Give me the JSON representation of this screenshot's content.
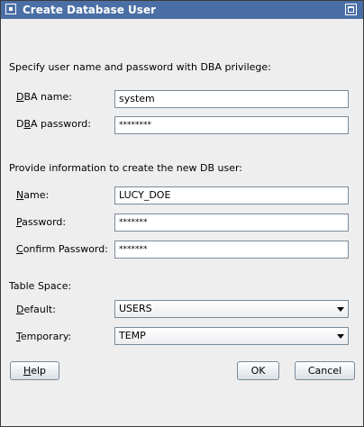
{
  "window": {
    "title": "Create Database User"
  },
  "dba_section": {
    "heading": "Specify user name and password with DBA privilege:",
    "name_label_mnemonic": "D",
    "name_label_rest": "BA name:",
    "name_value": "system",
    "password_label_pre": "D",
    "password_label_mnemonic": "B",
    "password_label_rest": "A password:",
    "password_value": "********"
  },
  "user_section": {
    "heading": "Provide information to create the new DB user:",
    "name_label_mnemonic": "N",
    "name_label_rest": "ame:",
    "name_value": "LUCY_DOE",
    "password_label_mnemonic": "P",
    "password_label_rest": "assword:",
    "password_value": "*******",
    "confirm_label_mnemonic": "C",
    "confirm_label_rest": "onfirm Password:",
    "confirm_value": "*******"
  },
  "tablespace_section": {
    "heading": "Table Space:",
    "default_label_mnemonic": "D",
    "default_label_rest": "efault:",
    "default_value": "USERS",
    "temporary_label_mnemonic": "T",
    "temporary_label_rest": "emporary:",
    "temporary_value": "TEMP"
  },
  "buttons": {
    "help_mnemonic": "H",
    "help_rest": "elp",
    "ok": "OK",
    "cancel": "Cancel"
  },
  "icons": {
    "window": "window-menu-icon",
    "maximize": "maximize-icon",
    "dropdown": "chevron-down-icon"
  },
  "colors": {
    "titlebar": "#4a6fa5",
    "dialog_background": "#eeeeee"
  }
}
